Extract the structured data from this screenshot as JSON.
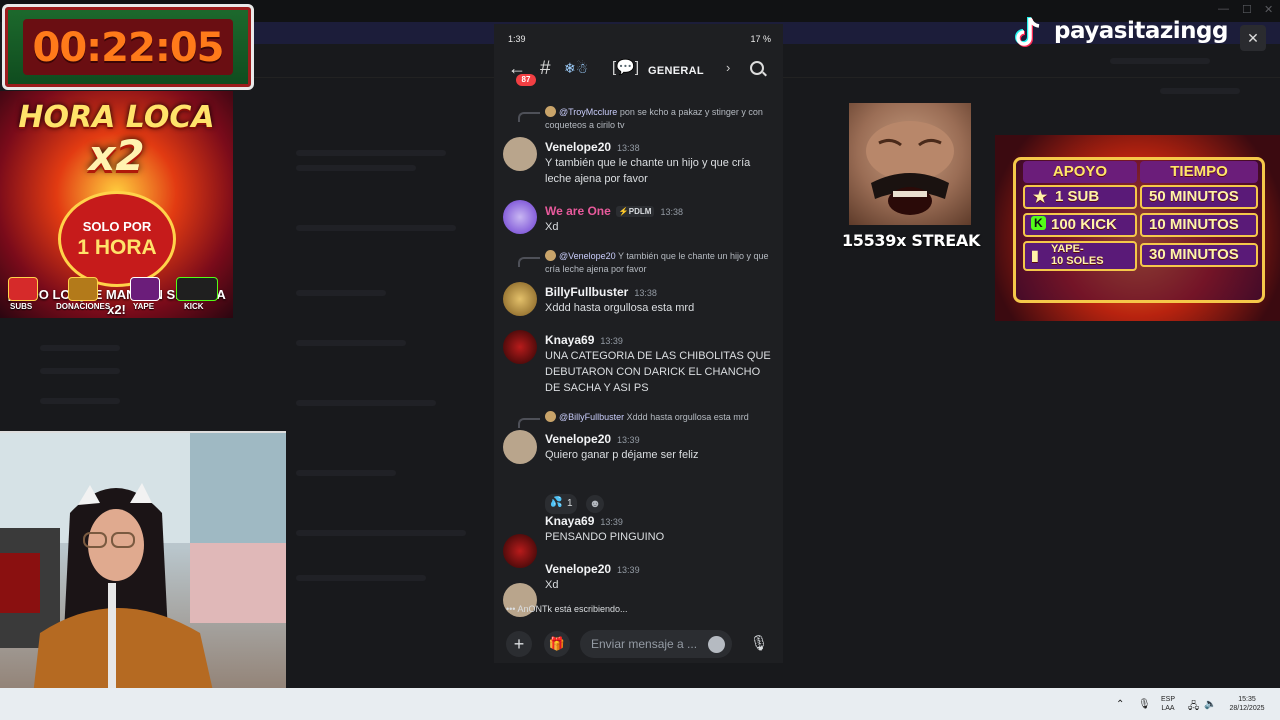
{
  "timer": {
    "value": "00:22:05"
  },
  "poster": {
    "title": "HORA LOCA",
    "multiplier": "x2",
    "badge_top": "SOLO POR",
    "badge_bottom": "1 HORA",
    "tagline": "¡TODO LO QUE MANDEN SE SUMA x2!",
    "categories": [
      "SUBS",
      "DONACIONES",
      "YAPE",
      "KICK"
    ]
  },
  "tiktok": {
    "handle": "payasitazingg"
  },
  "streak": {
    "label": "15539x STREAK"
  },
  "support_table": {
    "headers": [
      "APOYO",
      "TIEMPO"
    ],
    "rows": [
      {
        "support": "1 SUB",
        "time": "50 MINUTOS"
      },
      {
        "support": "100 KICK",
        "time": "10 MINUTOS"
      },
      {
        "support": "YAPE-\n10 SOLES",
        "time": "30 MINUTOS"
      }
    ]
  },
  "phone": {
    "status": {
      "time": "1:39",
      "battery": "17 %"
    },
    "header": {
      "unread_badge": "87",
      "channel_name": "GENERAL"
    },
    "messages": [
      {
        "reply_to_user": "@TroyMcclure",
        "reply_text": "pon se kcho a pakaz y stinger y con coqueteos a cirilo tv"
      },
      {
        "user": "Venelope20",
        "time": "13:38",
        "text": "Y también que le chante un hijo y que cría leche ajena por favor"
      },
      {
        "user": "We are One",
        "tag": "PDLM",
        "time": "13:38",
        "text": "Xd"
      },
      {
        "reply_to_user": "@Venelope20",
        "reply_text": "Y también que le chante un hijo y que cría leche ajena por favor"
      },
      {
        "user": "BillyFullbuster",
        "time": "13:38",
        "text": "Xddd hasta orgullosa esta mrd"
      },
      {
        "user": "Knaya69",
        "time": "13:39",
        "text": "UNA CATEGORIA DE LAS CHIBOLITAS QUE DEBUTARON CON DARICK EL CHANCHO DE SACHA Y ASI PS"
      },
      {
        "reply_to_user": "@BillyFullbuster",
        "reply_text": "Xddd hasta orgullosa esta mrd"
      },
      {
        "user": "Venelope20",
        "time": "13:39",
        "text": "Quiero ganar p déjame ser feliz",
        "reaction_count": "1"
      },
      {
        "user": "Knaya69",
        "time": "13:39",
        "text": "PENSANDO PINGUINO"
      },
      {
        "user": "Venelope20",
        "time": "13:39",
        "text": "Xd"
      }
    ],
    "typing": "AnONTk está escribiendo...",
    "composer_placeholder": "Enviar mensaje a ..."
  },
  "taskbar": {
    "lang": "ESP",
    "layout": "LAA",
    "time": "15:35",
    "date": "28/12/2025"
  },
  "colors": {
    "discord_bg": "#1e1f22",
    "mention_name": "#c9cdfb",
    "we_are_one": "#e85a9c",
    "timer_orange": "#ff7a1a",
    "notification_red": "#f23f43"
  }
}
